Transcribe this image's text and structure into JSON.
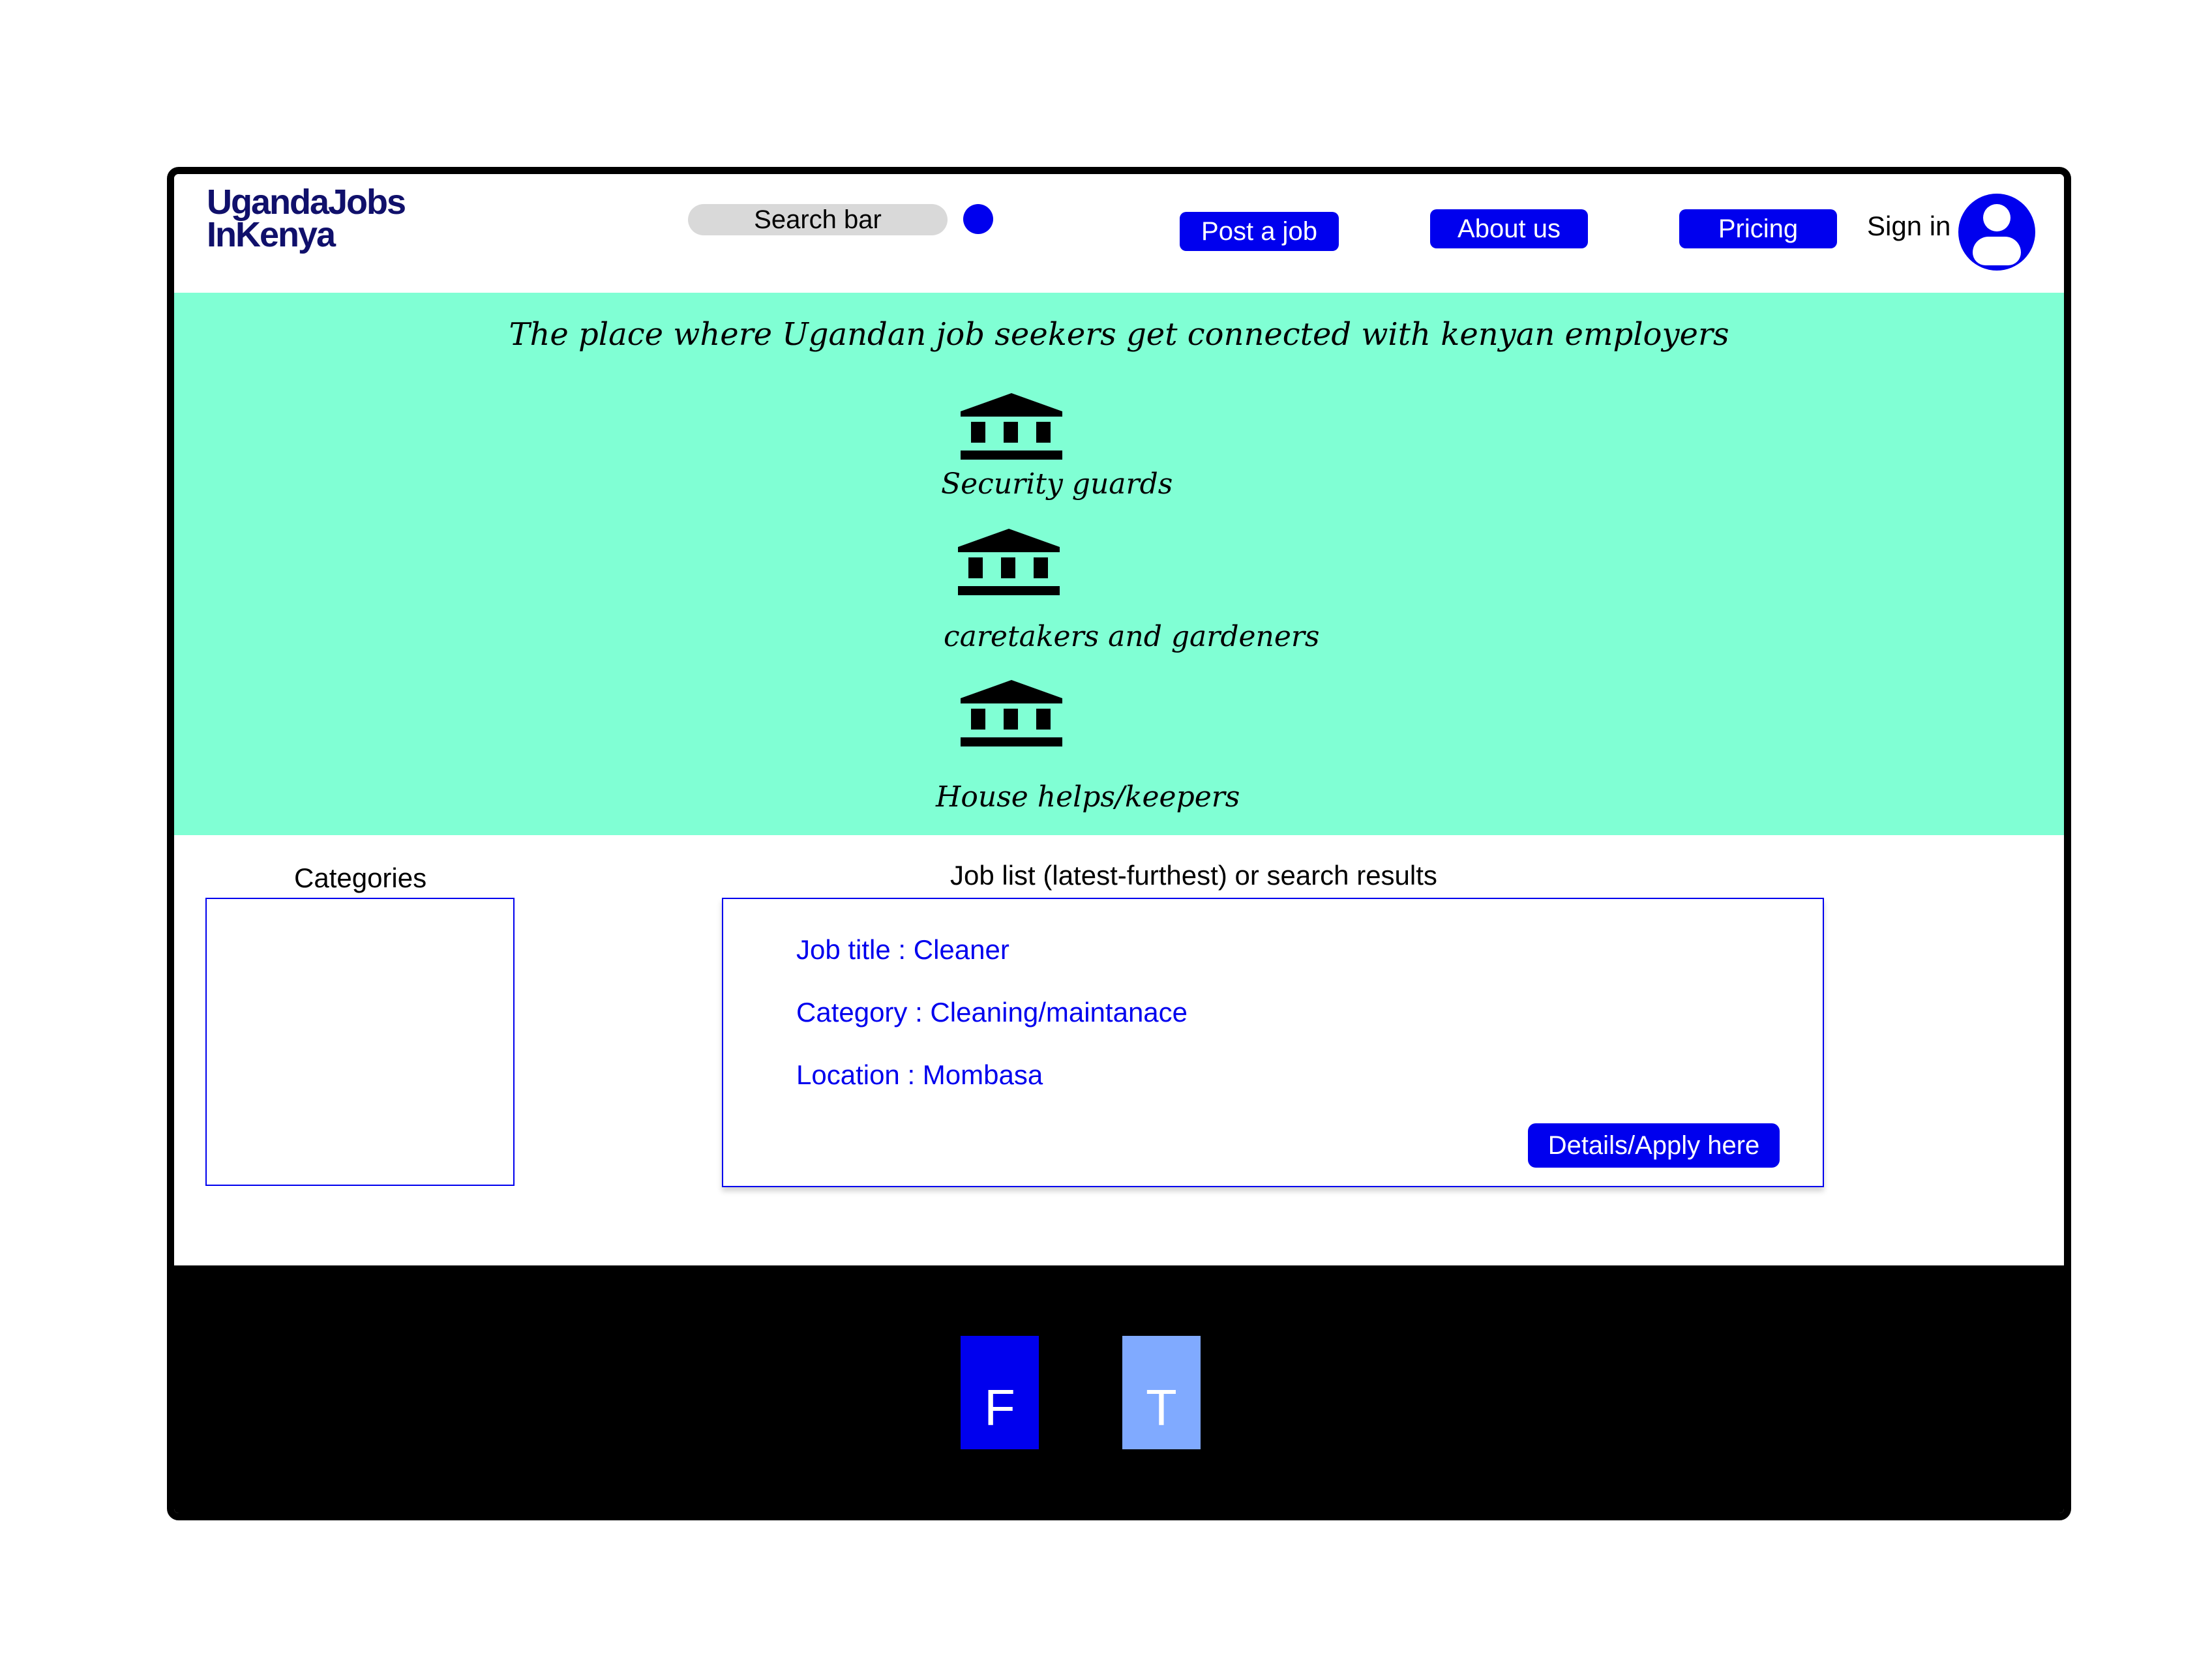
{
  "header": {
    "logo_line1": "UgandaJobs",
    "logo_line2": "InKenya",
    "search_label": "Search bar",
    "post_job": "Post a job",
    "about_us": "About us",
    "pricing": "Pricing",
    "sign_in": "Sign in"
  },
  "hero": {
    "tagline": "The place where Ugandan job seekers get connected with kenyan employers",
    "categories": [
      {
        "label": "Security guards",
        "icon": "bank-icon"
      },
      {
        "label": "caretakers and gardeners",
        "icon": "bank-icon"
      },
      {
        "label": "House helps/keepers",
        "icon": "bank-icon"
      }
    ]
  },
  "main": {
    "categories_title": "Categories",
    "joblist_title": "Job list (latest-furthest) or search results",
    "job": {
      "title": "Job title : Cleaner",
      "category": "Category : Cleaning/maintanace",
      "location": "Location : Mombasa",
      "apply": "Details/Apply here"
    }
  },
  "footer": {
    "facebook": "F",
    "twitter": "T"
  },
  "colors": {
    "accent": "#0000ee",
    "hero_bg": "#80ffd4",
    "footer_bg": "#000000",
    "twitter_bg": "#80aaff"
  }
}
